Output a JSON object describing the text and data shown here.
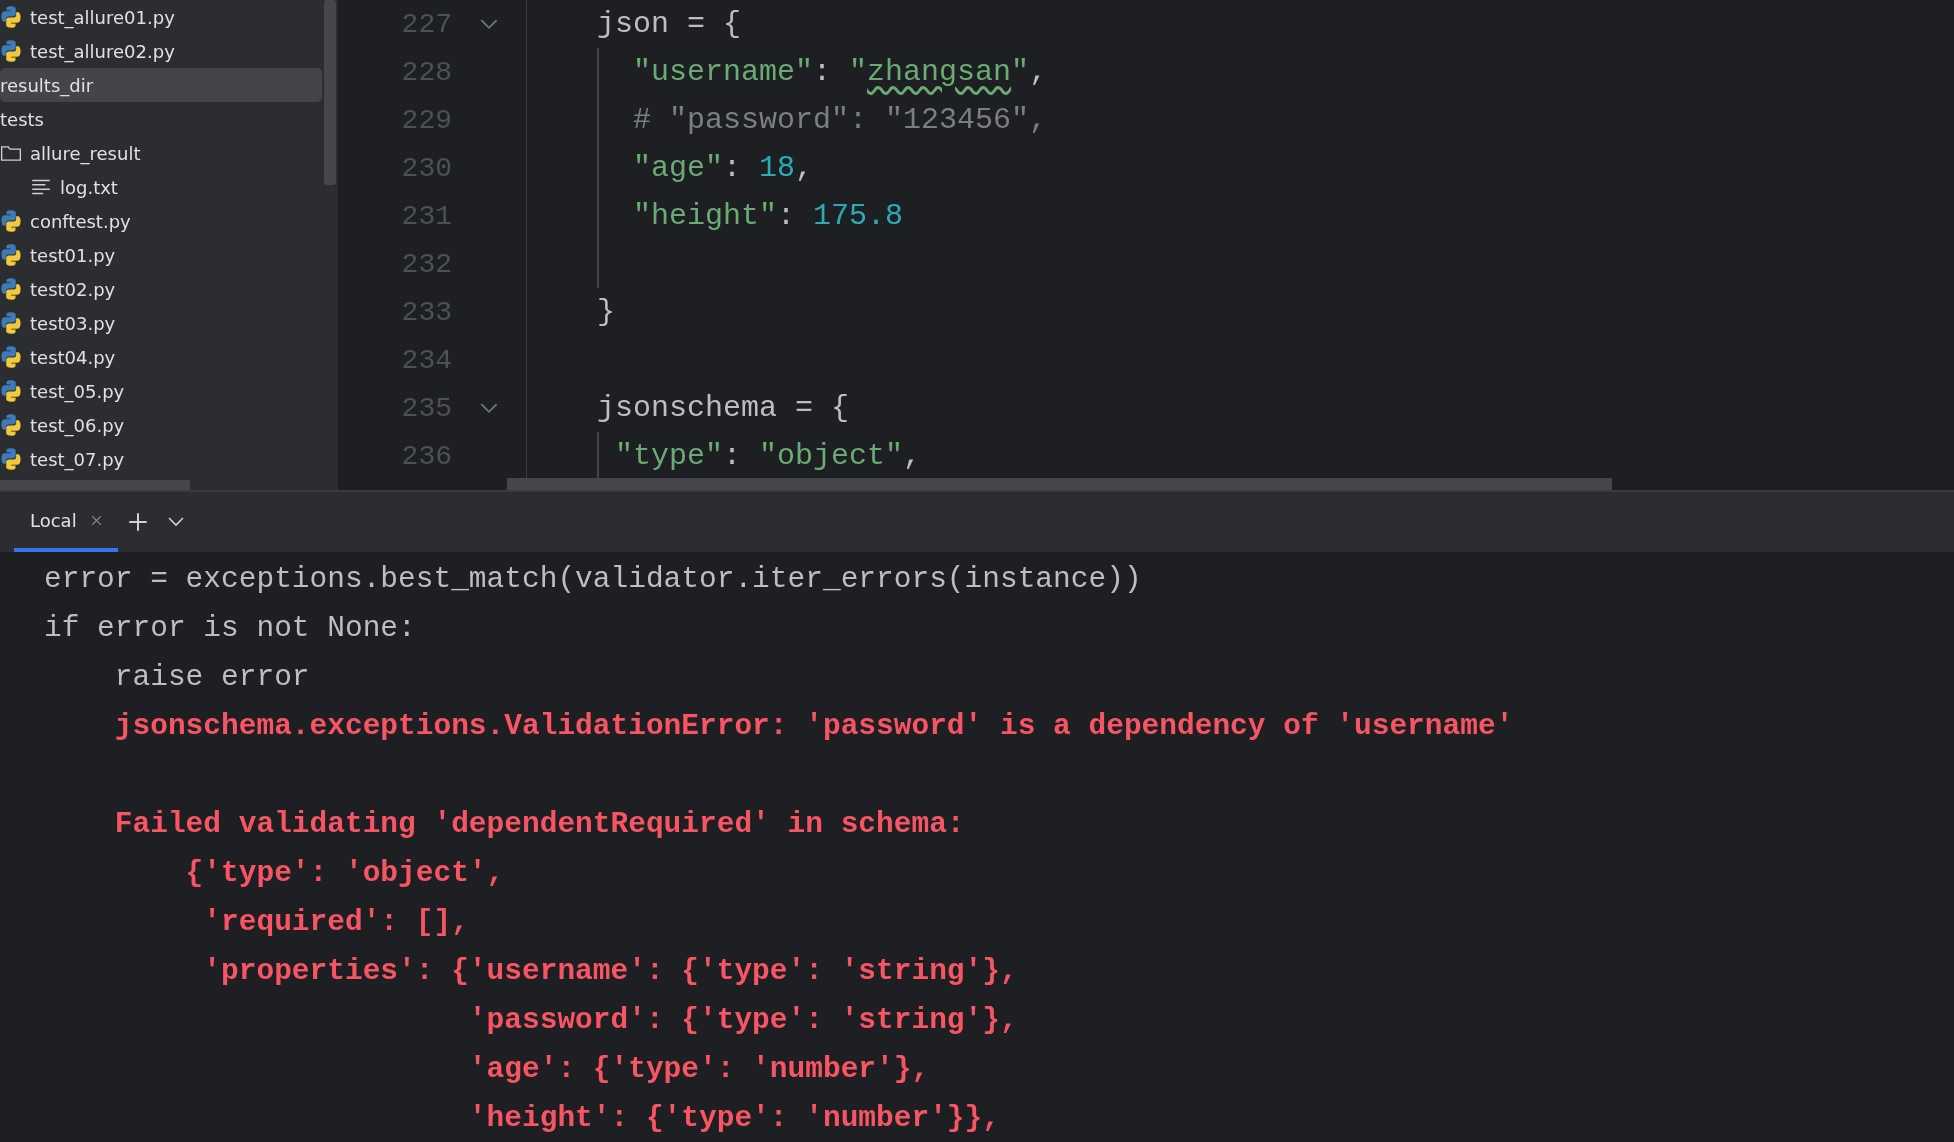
{
  "project_tree": {
    "items": [
      {
        "name": "test_allure01.py",
        "kind": "python",
        "selected": false
      },
      {
        "name": "test_allure02.py",
        "kind": "python",
        "selected": false
      },
      {
        "name": "results_dir",
        "kind": "plain",
        "selected": true
      },
      {
        "name": "tests",
        "kind": "plain",
        "selected": false
      },
      {
        "name": "allure_result",
        "kind": "folder",
        "selected": false,
        "children": [
          {
            "name": "log.txt",
            "kind": "text",
            "selected": false
          }
        ]
      },
      {
        "name": "conftest.py",
        "kind": "python",
        "selected": false
      },
      {
        "name": "test01.py",
        "kind": "python",
        "selected": false
      },
      {
        "name": "test02.py",
        "kind": "python",
        "selected": false
      },
      {
        "name": "test03.py",
        "kind": "python",
        "selected": false
      },
      {
        "name": "test04.py",
        "kind": "python",
        "selected": false
      },
      {
        "name": "test_05.py",
        "kind": "python",
        "selected": false
      },
      {
        "name": "test_06.py",
        "kind": "python",
        "selected": false
      },
      {
        "name": "test_07.py",
        "kind": "python",
        "selected": false
      }
    ]
  },
  "editor": {
    "lines": [
      {
        "number": "227",
        "fold": true,
        "guide": false,
        "tokens": [
          {
            "kind": "plain",
            "text": "json = {"
          }
        ]
      },
      {
        "number": "228",
        "fold": false,
        "guide": true,
        "tokens": [
          {
            "kind": "string",
            "text": "  \"username\""
          },
          {
            "kind": "plain",
            "text": ": "
          },
          {
            "kind": "string",
            "text": "\""
          },
          {
            "kind": "typo",
            "text": "zhangsan"
          },
          {
            "kind": "string",
            "text": "\""
          },
          {
            "kind": "plain",
            "text": ","
          }
        ]
      },
      {
        "number": "229",
        "fold": false,
        "guide": true,
        "tokens": [
          {
            "kind": "comment",
            "text": "  # \"password\": \"123456\","
          }
        ]
      },
      {
        "number": "230",
        "fold": false,
        "guide": true,
        "tokens": [
          {
            "kind": "string",
            "text": "  \"age\""
          },
          {
            "kind": "plain",
            "text": ": "
          },
          {
            "kind": "number",
            "text": "18"
          },
          {
            "kind": "plain",
            "text": ","
          }
        ]
      },
      {
        "number": "231",
        "fold": false,
        "guide": true,
        "tokens": [
          {
            "kind": "string",
            "text": "  \"height\""
          },
          {
            "kind": "plain",
            "text": ": "
          },
          {
            "kind": "number",
            "text": "175.8"
          }
        ]
      },
      {
        "number": "232",
        "fold": false,
        "guide": true
      },
      {
        "number": "233",
        "fold": false,
        "guide": false,
        "tokens": [
          {
            "kind": "plain",
            "text": "}"
          }
        ]
      },
      {
        "number": "234",
        "fold": false,
        "guide": false
      },
      {
        "number": "235",
        "fold": true,
        "guide": false,
        "tokens": [
          {
            "kind": "plain",
            "text": "jsonschema = {"
          }
        ]
      },
      {
        "number": "236",
        "fold": false,
        "guide": true,
        "tokens": [
          {
            "kind": "string",
            "text": " \"type\""
          },
          {
            "kind": "plain",
            "text": ": "
          },
          {
            "kind": "string",
            "text": "\"object\""
          },
          {
            "kind": "plain",
            "text": ","
          }
        ]
      }
    ]
  },
  "terminal": {
    "tabs": [
      {
        "label": "Local",
        "selected": true
      }
    ],
    "lines": [
      {
        "kind": "output",
        "text": "error = exceptions.best_match(validator.iter_errors(instance))"
      },
      {
        "kind": "output",
        "text": "if error is not None:"
      },
      {
        "kind": "output",
        "text": "    raise error"
      },
      {
        "kind": "error",
        "text": "    jsonschema.exceptions.ValidationError: 'password' is a dependency of 'username'"
      },
      {
        "kind": "blank"
      },
      {
        "kind": "error",
        "text": "    Failed validating 'dependentRequired' in schema:"
      },
      {
        "kind": "error",
        "text": "        {'type': 'object',"
      },
      {
        "kind": "error",
        "text": "         'required': [],"
      },
      {
        "kind": "error",
        "text": "         'properties': {'username': {'type': 'string'},"
      },
      {
        "kind": "error",
        "text": "                        'password': {'type': 'string'},"
      },
      {
        "kind": "error",
        "text": "                        'age': {'type': 'number'},"
      },
      {
        "kind": "error",
        "text": "                        'height': {'type': 'number'}},"
      }
    ]
  }
}
